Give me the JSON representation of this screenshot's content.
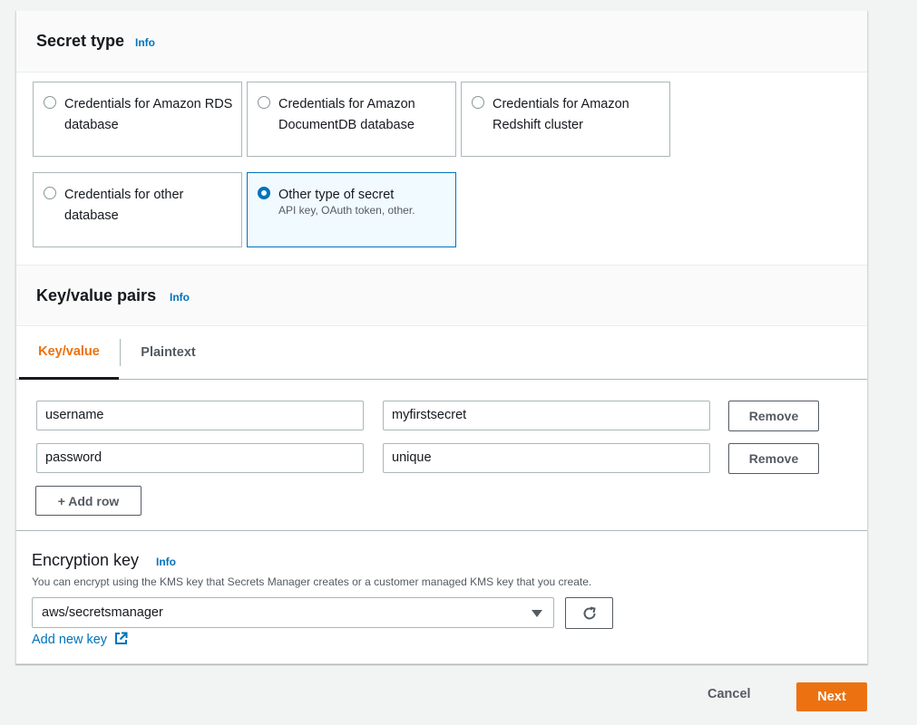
{
  "secret_type": {
    "title": "Secret type",
    "info": "Info",
    "options": [
      {
        "label": "Credentials for Amazon RDS database",
        "description": ""
      },
      {
        "label": "Credentials for Amazon DocumentDB database",
        "description": ""
      },
      {
        "label": "Credentials for Amazon Redshift cluster",
        "description": ""
      },
      {
        "label": "Credentials for other database",
        "description": ""
      },
      {
        "label": "Other type of secret",
        "description": "API key, OAuth token, other."
      }
    ],
    "selected": "Other type of secret"
  },
  "kv_pairs": {
    "title": "Key/value pairs",
    "info": "Info",
    "tabs": [
      {
        "label": "Key/value",
        "active": true
      },
      {
        "label": "Plaintext",
        "active": false
      }
    ],
    "rows": [
      {
        "key": "username",
        "value": "myfirstsecret",
        "remove_label": "Remove"
      },
      {
        "key": "password",
        "value": "unique",
        "remove_label": "Remove"
      }
    ],
    "add_row_label": "+ Add row"
  },
  "encryption": {
    "title": "Encryption key",
    "info": "Info",
    "description": "You can encrypt using the KMS key that Secrets Manager creates or a customer managed KMS key that you create.",
    "selected_key": "aws/secretsmanager",
    "add_new_key_label": "Add new key"
  },
  "footer": {
    "cancel_label": "Cancel",
    "next_label": "Next"
  },
  "colors": {
    "accent": "#ec7211",
    "link": "#0073bb",
    "selected_border": "#0073bb",
    "selected_bg": "#f1faff"
  },
  "icons": {
    "refresh": "refresh-icon",
    "external_link": "external-link-icon",
    "dropdown": "caret-down-icon"
  }
}
